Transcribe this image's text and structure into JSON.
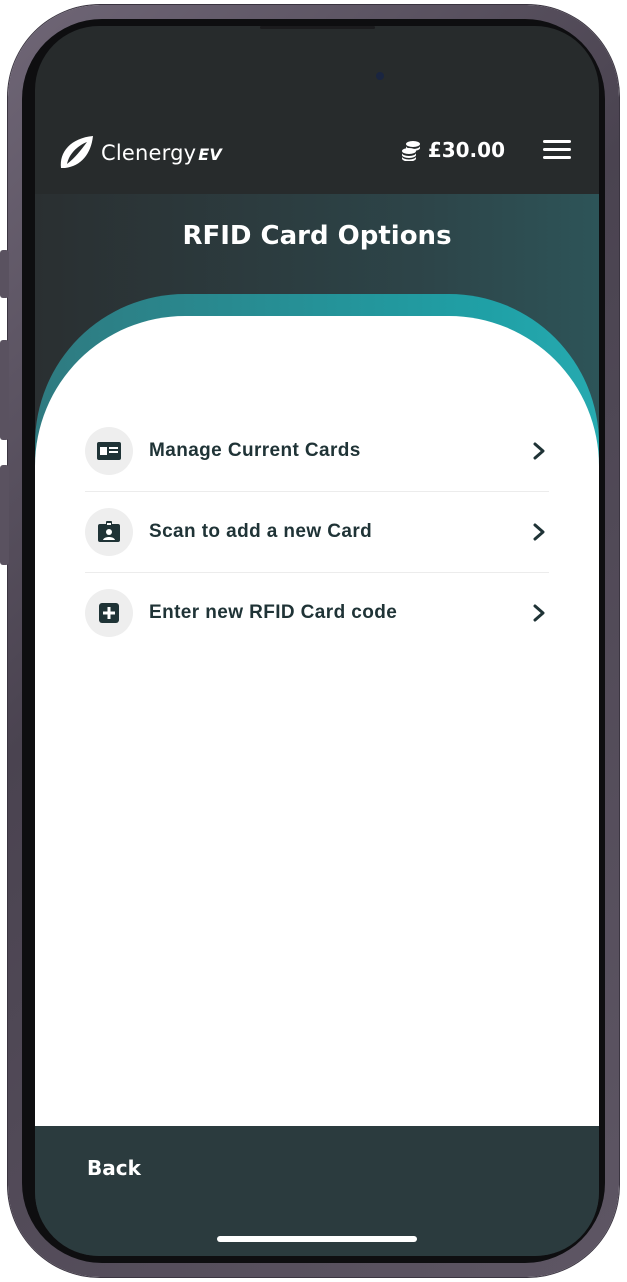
{
  "header": {
    "logo_name": "Clenergy",
    "logo_suffix": "EV",
    "balance": "£30.00",
    "balance_icon": "coins-icon",
    "menu_icon": "hamburger-menu-icon"
  },
  "page": {
    "title": "RFID Card Options"
  },
  "options": [
    {
      "label": "Manage Current Cards",
      "icon": "id-card-icon"
    },
    {
      "label": "Scan to add a new Card",
      "icon": "id-badge-icon"
    },
    {
      "label": "Enter new RFID Card code",
      "icon": "plus-square-icon"
    }
  ],
  "footer": {
    "back_label": "Back"
  },
  "colors": {
    "header_bg": "#272b2c",
    "accent_teal": "#1fa0a6",
    "footer_bg": "#2b3b3e",
    "text_dark": "#1f3336"
  }
}
